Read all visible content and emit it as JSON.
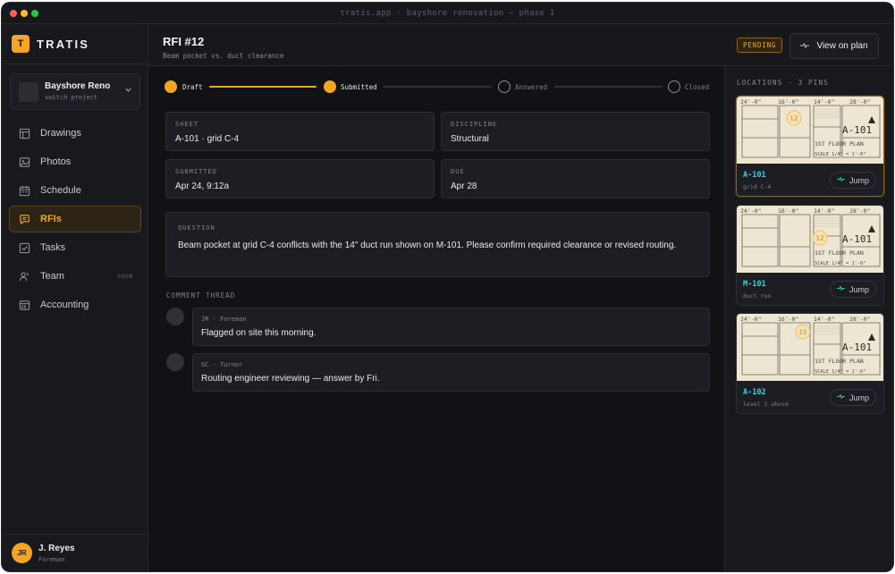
{
  "window": {
    "title": "tratis.app · bayshore renovation — phase 1"
  },
  "brand": {
    "logo_letter": "T",
    "name": "TRATIS",
    "accent": "#f5a524"
  },
  "project": {
    "name": "Bayshore Reno",
    "sub": "switch project",
    "chevron": "chevron-down-icon"
  },
  "nav": {
    "items": [
      {
        "label": "Drawings",
        "icon": "drawings-icon",
        "active": false,
        "badge": ""
      },
      {
        "label": "Photos",
        "icon": "photos-icon",
        "active": false,
        "badge": ""
      },
      {
        "label": "Schedule",
        "icon": "calendar-icon",
        "active": false,
        "badge": ""
      },
      {
        "label": "RFIs",
        "icon": "chat-icon",
        "active": true,
        "badge": ""
      },
      {
        "label": "Tasks",
        "icon": "checkbox-icon",
        "active": false,
        "badge": ""
      },
      {
        "label": "Team",
        "icon": "team-icon",
        "active": false,
        "badge": "SOON"
      },
      {
        "label": "Accounting",
        "icon": "accounting-icon",
        "active": false,
        "badge": ""
      }
    ]
  },
  "user": {
    "initials": "JR",
    "name": "J. Reyes",
    "role": "Foreman"
  },
  "header": {
    "title": "RFI #12",
    "subtitle": "Beam pocket vs. duct clearance",
    "status": "PENDING",
    "view_button": "View on plan"
  },
  "stepper": {
    "steps": [
      {
        "label": "Draft",
        "done": true
      },
      {
        "label": "Submitted",
        "done": true
      },
      {
        "label": "Answered",
        "done": false
      },
      {
        "label": "Closed",
        "done": false
      }
    ]
  },
  "details": {
    "sheet_label": "SHEET",
    "sheet_value": "A-101 · grid C-4",
    "discipline_label": "DISCIPLINE",
    "discipline_value": "Structural",
    "submitted_label": "SUBMITTED",
    "submitted_value": "Apr 24, 9:12a",
    "due_label": "DUE",
    "due_value": "Apr 28"
  },
  "question": {
    "label": "QUESTION",
    "text": "Beam pocket at grid C-4 conflicts with the 14\" duct run shown on M-101. Please confirm required clearance or revised routing."
  },
  "thread": {
    "title": "COMMENT THREAD",
    "comments": [
      {
        "author": "JR · Foreman",
        "text": "Flagged on site this morning."
      },
      {
        "author": "GC · Turner",
        "text": "Routing engineer reviewing — answer by Fri."
      }
    ]
  },
  "locations": {
    "title": "LOCATIONS · 3 PINS",
    "jump_label": "Jump",
    "plan_text": {
      "dim1": "24'-0\"",
      "dim2": "16'-0\"",
      "dim3": "14'-0\"",
      "dim4": "28'-0\"",
      "sheet": "A-101",
      "plan_title": "1ST FLOOR PLAN",
      "scale": "SCALE 1/4\" = 1'-0\"",
      "pin_number": "12"
    },
    "pins": [
      {
        "code": "A-101",
        "desc": "grid C-4",
        "active": true
      },
      {
        "code": "M-101",
        "desc": "duct run",
        "active": false
      },
      {
        "code": "A-102",
        "desc": "level 2 above",
        "active": false
      }
    ]
  }
}
